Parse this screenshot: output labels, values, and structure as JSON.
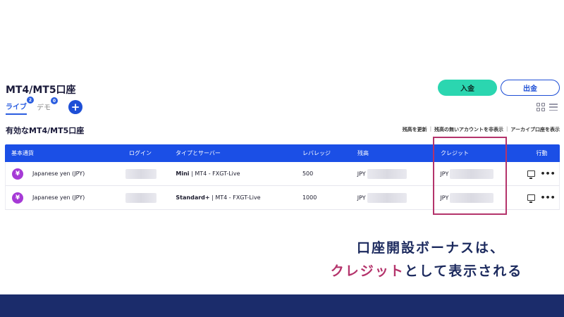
{
  "header": {
    "title": "MT4/MT5口座",
    "deposit_label": "入金",
    "withdraw_label": "出金"
  },
  "tabs": [
    {
      "label": "ライブ",
      "count": "2",
      "active": true
    },
    {
      "label": "デモ",
      "count": "0",
      "active": false
    }
  ],
  "add_button_label": "+",
  "section": {
    "title": "有効なMT4/MT5口座",
    "links": [
      "残高を更新",
      "残高の無いアカウントを非表示",
      "アーカイブ口座を表示"
    ]
  },
  "table": {
    "headers": [
      "基本通貨",
      "ログイン",
      "タイプとサーバー",
      "レバレッジ",
      "残高",
      "クレジット",
      "行動"
    ],
    "rows": [
      {
        "currency_symbol": "¥",
        "currency": "Japanese yen (JPY)",
        "type": "Mini",
        "server": " | MT4 - FXGT-Live",
        "leverage": "500",
        "balance_prefix": "JPY",
        "credit_prefix": "JPY"
      },
      {
        "currency_symbol": "¥",
        "currency": "Japanese yen (JPY)",
        "type": "Standard+",
        "server": " | MT4 - FXGT-Live",
        "leverage": "1000",
        "balance_prefix": "JPY",
        "credit_prefix": "JPY"
      }
    ]
  },
  "caption": {
    "line1": "口座開設ボーナスは、",
    "line2_accent": "クレジット",
    "line2_rest": "として表示される"
  },
  "colors": {
    "accent_teal": "#2bd6b0",
    "primary_blue": "#1b4fe6",
    "highlight_magenta": "#b4336b",
    "footer_navy": "#1b2c6b",
    "currency_purple": "#a63ad6"
  }
}
